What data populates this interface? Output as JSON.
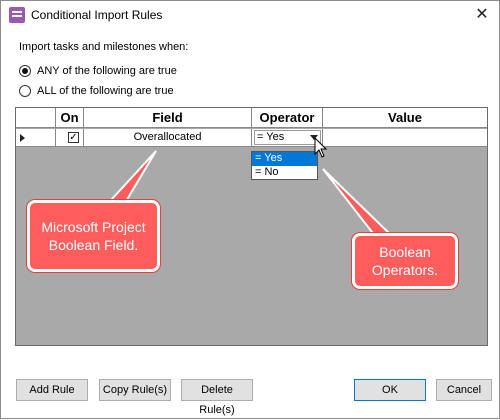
{
  "window": {
    "title": "Conditional Import Rules",
    "close_glyph": "✕"
  },
  "intro": "Import tasks and milestones when:",
  "radios": {
    "any_label": "ANY of the following are true",
    "all_label": "ALL of the following are true"
  },
  "grid": {
    "columns": [
      "On",
      "Field",
      "Operator",
      "Value"
    ],
    "rows": [
      {
        "on_glyph": "✓",
        "field": "Overallocated",
        "operator": "= Yes",
        "value": ""
      }
    ]
  },
  "dropdown": {
    "options": [
      "= Yes",
      "= No"
    ]
  },
  "callouts": {
    "field_note": "Microsoft Project Boolean Field.",
    "operator_note": "Boolean Operators."
  },
  "buttons": {
    "add": "Add Rule",
    "copy": "Copy Rule(s)",
    "delete": "Delete Rule(s)",
    "ok": "OK",
    "cancel": "Cancel"
  },
  "colors": {
    "callout": "#ff5c5c",
    "highlight": "#0078d7",
    "grid_empty": "#a9a9a9"
  },
  "icons": {
    "app": "project-app-icon",
    "row_indicator": "current-row-arrow-icon",
    "dropdown": "chevron-down-icon"
  }
}
